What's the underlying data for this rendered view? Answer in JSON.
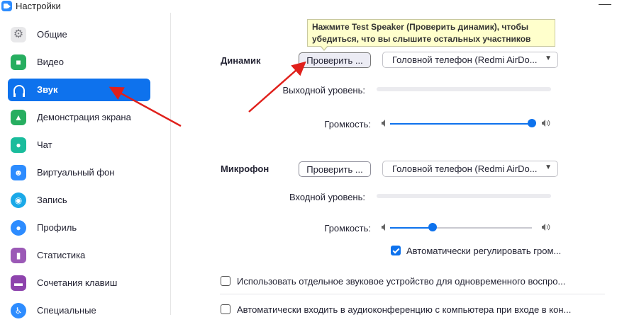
{
  "window": {
    "title": "Настройки"
  },
  "sidebar": {
    "items": [
      {
        "label": "Общие",
        "icon": "gear-icon",
        "color": "#e8e8ea",
        "active": false
      },
      {
        "label": "Видео",
        "icon": "video-icon",
        "color": "#27ae60",
        "active": false
      },
      {
        "label": "Звук",
        "icon": "headphones-icon",
        "color": "#0e72ed",
        "active": true
      },
      {
        "label": "Демонстрация экрана",
        "icon": "share-screen-icon",
        "color": "#27ae60",
        "active": false
      },
      {
        "label": "Чат",
        "icon": "chat-icon",
        "color": "#1abc9c",
        "active": false
      },
      {
        "label": "Виртуальный фон",
        "icon": "virtual-background-icon",
        "color": "#2d8cff",
        "active": false
      },
      {
        "label": "Запись",
        "icon": "record-icon",
        "color": "#1aa9e8",
        "active": false
      },
      {
        "label": "Профиль",
        "icon": "profile-icon",
        "color": "#2d8cff",
        "active": false
      },
      {
        "label": "Статистика",
        "icon": "statistics-icon",
        "color": "#9b59b6",
        "active": false
      },
      {
        "label": "Сочетания клавиш",
        "icon": "keyboard-icon",
        "color": "#8e44ad",
        "active": false
      },
      {
        "label": "Специальные",
        "icon": "accessibility-icon",
        "color": "#2d8cff",
        "active": false
      }
    ]
  },
  "tooltip": {
    "text": "Нажмите Test Speaker (Проверить динамик), чтобы убедиться, что вы слышите остальных участников"
  },
  "speaker": {
    "label": "Динамик",
    "test_button": "Проверить ...",
    "device": "Головной телефон (Redmi AirDo...",
    "output_level_label": "Выходной уровень:",
    "volume_label": "Громкость:",
    "volume": 1.0
  },
  "microphone": {
    "label": "Микрофон",
    "test_button": "Проверить ...",
    "device": "Головной телефон (Redmi AirDo...",
    "input_level_label": "Входной уровень:",
    "volume_label": "Громкость:",
    "volume": 0.3,
    "auto_adjust_label": "Автоматически регулировать гром...",
    "auto_adjust_checked": true
  },
  "options": {
    "separate_device_label": "Использовать отдельное звуковое устройство для одновременного воспро...",
    "separate_device_checked": false,
    "auto_join_label": "Автоматически входить в аудиоконференцию с компьютера при входе в кон...",
    "auto_join_checked": false
  },
  "colors": {
    "accent": "#0e72ed",
    "annotation_arrow": "#e0201b",
    "tooltip_bg": "#ffffcc"
  }
}
